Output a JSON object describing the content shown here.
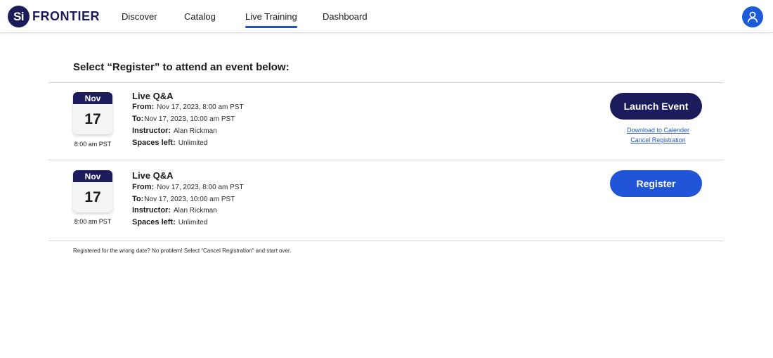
{
  "brand": {
    "logo_mark": "Si",
    "name": "FRONTIER",
    "color": "#1c1b5c"
  },
  "nav": [
    {
      "label": "Discover",
      "active": false
    },
    {
      "label": "Catalog",
      "active": false
    },
    {
      "label": "Live Training",
      "active": true
    },
    {
      "label": "Dashboard",
      "active": false
    }
  ],
  "user": {
    "icon": "user-icon"
  },
  "heading": "Select “Register” to attend an event below:",
  "events": [
    {
      "month": "Nov",
      "day": "17",
      "time": "8:00 am PST",
      "title": "Live Q&A",
      "from_label": "From:",
      "from_value": "Nov 17, 2023, 8:00 am PST",
      "to_label": "To:",
      "to_value": "Nov 17, 2023, 10:00 am PST",
      "instructor_label": "Instructor:",
      "instructor_value": "Alan Rickman",
      "spaces_label": "Spaces left:",
      "spaces_value": "Unlimited",
      "button_label": "Launch Event",
      "links": [
        "Download to Calender",
        "Cancel Registration"
      ]
    },
    {
      "month": "Nov",
      "day": "17",
      "time": "8:00 am PST",
      "title": "Live Q&A",
      "from_label": "From:",
      "from_value": "Nov 17, 2023, 8:00 am PST",
      "to_label": "To:",
      "to_value": "Nov 17, 2023, 10:00 am PST",
      "instructor_label": "Instructor:",
      "instructor_value": "Alan Rickman",
      "spaces_label": "Spaces left:",
      "spaces_value": "Unlimited",
      "button_label": "Register"
    }
  ],
  "footnote": "Registered for the wrong date? No problem! Select “Cancel Registration” and start over.",
  "colors": {
    "navy": "#1c1b5c",
    "primary_blue": "#1f55d6",
    "link": "#2a55c6",
    "divider": "#d9d9d9"
  }
}
